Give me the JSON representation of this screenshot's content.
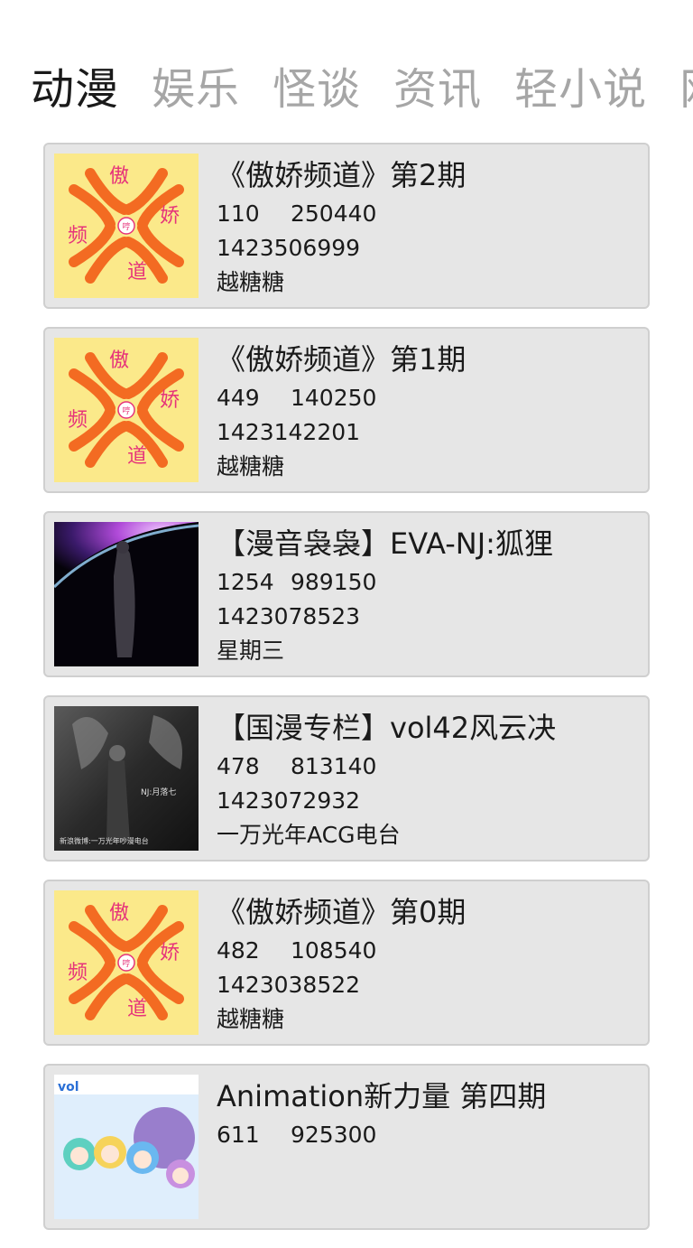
{
  "tabs": [
    "动漫",
    "娱乐",
    "怪谈",
    "资讯",
    "轻小说",
    "网"
  ],
  "items": [
    {
      "title": "《傲娇频道》第2期",
      "views": "110",
      "count": "250440",
      "timestamp": "1423506999",
      "author": "越糖糖",
      "thumb": "tsundere-logo"
    },
    {
      "title": "《傲娇频道》第1期",
      "views": "449",
      "count": "140250",
      "timestamp": "1423142201",
      "author": "越糖糖",
      "thumb": "tsundere-logo"
    },
    {
      "title": "【漫音袅袅】EVA-NJ:狐狸",
      "views": "1254",
      "count": "989150",
      "timestamp": "1423078523",
      "author": "星期三",
      "thumb": "eva-space-art"
    },
    {
      "title": "【国漫专栏】vol42风云决",
      "views": "478",
      "count": "813140",
      "timestamp": "1423072932",
      "author": "一万光年ACG电台",
      "thumb": "fengyunjue-poster"
    },
    {
      "title": "《傲娇频道》第0期",
      "views": "482",
      "count": "108540",
      "timestamp": "1423038522",
      "author": "越糖糖",
      "thumb": "tsundere-logo"
    },
    {
      "title": "Animation新力量 第四期",
      "views": "611",
      "count": "925300",
      "timestamp": "",
      "author": "",
      "thumb": "anime-characters-art"
    }
  ],
  "logo_text": {
    "top": "傲",
    "right": "娇",
    "left": "频",
    "bottom": "道",
    "center": "哼"
  },
  "art_text": {
    "poster_line": "NJ:月落七",
    "poster_bottom": "新浪微博:一万光年吵漫电台",
    "anime_tag": "vol"
  },
  "colors": {
    "logo_bg": "#fbe98a",
    "logo_orange": "#f36b22",
    "logo_pink": "#e6337a",
    "card_bg": "#e6e6e6",
    "tab_inactive": "#a6a6a6"
  }
}
